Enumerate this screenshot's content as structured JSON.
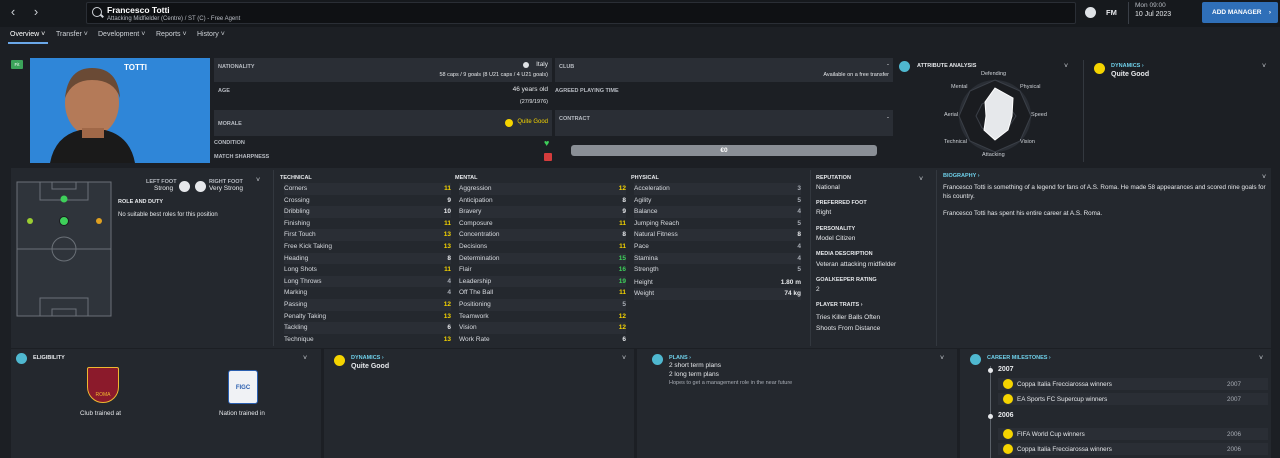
{
  "topbar": {
    "player_name": "Francesco Totti",
    "subtitle": "Attacking Midfielder (Centre) / ST (C) - Free Agent",
    "fm_label": "FM",
    "day_time": "Mon 09:00",
    "date": "10 Jul 2023",
    "add_manager": "ADD MANAGER",
    "back_icon": "chevron-left-icon",
    "forward_icon": "chevron-right-icon"
  },
  "tabs": [
    {
      "label": "Overview"
    },
    {
      "label": "Transfer"
    },
    {
      "label": "Development"
    },
    {
      "label": "Reports"
    },
    {
      "label": "History"
    }
  ],
  "profile": {
    "badge": "Fit",
    "short_name": "TOTTI",
    "shirt_color": "#2f86d8"
  },
  "info": {
    "nationality_label": "NATIONALITY",
    "nationality": "Italy",
    "caps": "58 caps / 9 goals (8 U21 caps / 4 U21 goals)",
    "age_label": "AGE",
    "age": "46 years old",
    "dob": "(27/9/1976)",
    "morale_label": "MORALE",
    "morale": "Quite Good",
    "condition_label": "CONDITION",
    "sharpness_label": "MATCH SHARPNESS",
    "club_label": "CLUB",
    "club": "-",
    "club_status": "Available on a free transfer",
    "playing_time_label": "AGREED PLAYING TIME",
    "contract_label": "CONTRACT",
    "contract": "-",
    "wage": "€0"
  },
  "attr_analysis": {
    "title": "ATTRIBUTE ANALYSIS",
    "labels": [
      "Defending",
      "Physical",
      "Speed",
      "Vision",
      "Attacking",
      "Technical",
      "Aerial",
      "Mental"
    ]
  },
  "dynamics_top": {
    "title": "DYNAMICS",
    "value": "Quite Good"
  },
  "feet": {
    "left_label": "LEFT FOOT",
    "left": "Strong",
    "right_label": "RIGHT FOOT",
    "right": "Very Strong"
  },
  "role": {
    "title": "ROLE AND DUTY",
    "text": "No suitable best roles for this position"
  },
  "technical": {
    "title": "TECHNICAL",
    "rows": [
      [
        "Corners",
        "11"
      ],
      [
        "Crossing",
        "9"
      ],
      [
        "Dribbling",
        "10"
      ],
      [
        "Finishing",
        "11"
      ],
      [
        "First Touch",
        "13"
      ],
      [
        "Free Kick Taking",
        "13"
      ],
      [
        "Heading",
        "8"
      ],
      [
        "Long Shots",
        "11"
      ],
      [
        "Long Throws",
        "4"
      ],
      [
        "Marking",
        "4"
      ],
      [
        "Passing",
        "12"
      ],
      [
        "Penalty Taking",
        "13"
      ],
      [
        "Tackling",
        "6"
      ],
      [
        "Technique",
        "13"
      ]
    ]
  },
  "mental": {
    "title": "MENTAL",
    "rows": [
      [
        "Aggression",
        "12"
      ],
      [
        "Anticipation",
        "8"
      ],
      [
        "Bravery",
        "9"
      ],
      [
        "Composure",
        "11"
      ],
      [
        "Concentration",
        "8"
      ],
      [
        "Decisions",
        "11"
      ],
      [
        "Determination",
        "15"
      ],
      [
        "Flair",
        "16"
      ],
      [
        "Leadership",
        "19"
      ],
      [
        "Off The Ball",
        "11"
      ],
      [
        "Positioning",
        "5"
      ],
      [
        "Teamwork",
        "12"
      ],
      [
        "Vision",
        "12"
      ],
      [
        "Work Rate",
        "6"
      ]
    ]
  },
  "physical": {
    "title": "PHYSICAL",
    "rows": [
      [
        "Acceleration",
        "3"
      ],
      [
        "Agility",
        "5"
      ],
      [
        "Balance",
        "4"
      ],
      [
        "Jumping Reach",
        "5"
      ],
      [
        "Natural Fitness",
        "8"
      ],
      [
        "Pace",
        "4"
      ],
      [
        "Stamina",
        "4"
      ],
      [
        "Strength",
        "5"
      ]
    ],
    "height_label": "Height",
    "height": "1.80 m",
    "weight_label": "Weight",
    "weight": "74 kg"
  },
  "details": {
    "reputation_label": "REPUTATION",
    "reputation": "National",
    "foot_label": "PREFERRED FOOT",
    "foot": "Right",
    "personality_label": "PERSONALITY",
    "personality": "Model Citizen",
    "media_label": "MEDIA DESCRIPTION",
    "media": "Veteran attacking midfielder",
    "gk_label": "GOALKEEPER RATING",
    "gk": "2",
    "traits_label": "PLAYER TRAITS",
    "traits": [
      "Tries Killer Balls Often",
      "Shoots From Distance"
    ]
  },
  "biography": {
    "title": "BIOGRAPHY",
    "p1": "Francesco Totti is something of a legend for fans of A.S. Roma. He made 58 appearances and scored nine goals for his country.",
    "p2": "Francesco Totti has spent his entire career at A.S. Roma."
  },
  "eligibility": {
    "title": "ELIGIBILITY",
    "club_trained": "Club trained at",
    "nation_trained": "Nation trained in",
    "club_logo_text": "ROMA",
    "nation_logo_text": "FIGC"
  },
  "dynamics_bottom": {
    "title": "DYNAMICS",
    "value": "Quite Good"
  },
  "plans": {
    "title": "PLANS",
    "short": "2 short term plans",
    "long": "2 long term plans",
    "hope": "Hopes to get a management role in the near future"
  },
  "milestones": {
    "title": "CAREER MILESTONES",
    "years": [
      {
        "year": "2007",
        "items": [
          [
            "Coppa Italia Frecciarossa winners",
            "2007"
          ],
          [
            "EA Sports FC Supercup winners",
            "2007"
          ]
        ]
      },
      {
        "year": "2006",
        "items": [
          [
            "FIFA World Cup winners",
            "2006"
          ],
          [
            "Coppa Italia Frecciarossa winners",
            "2006"
          ]
        ]
      }
    ]
  },
  "colors": {
    "yellow": "#f5d400",
    "green": "#3ecf5a",
    "accent": "#6fd0ea",
    "blue": "#2f6fb8"
  }
}
